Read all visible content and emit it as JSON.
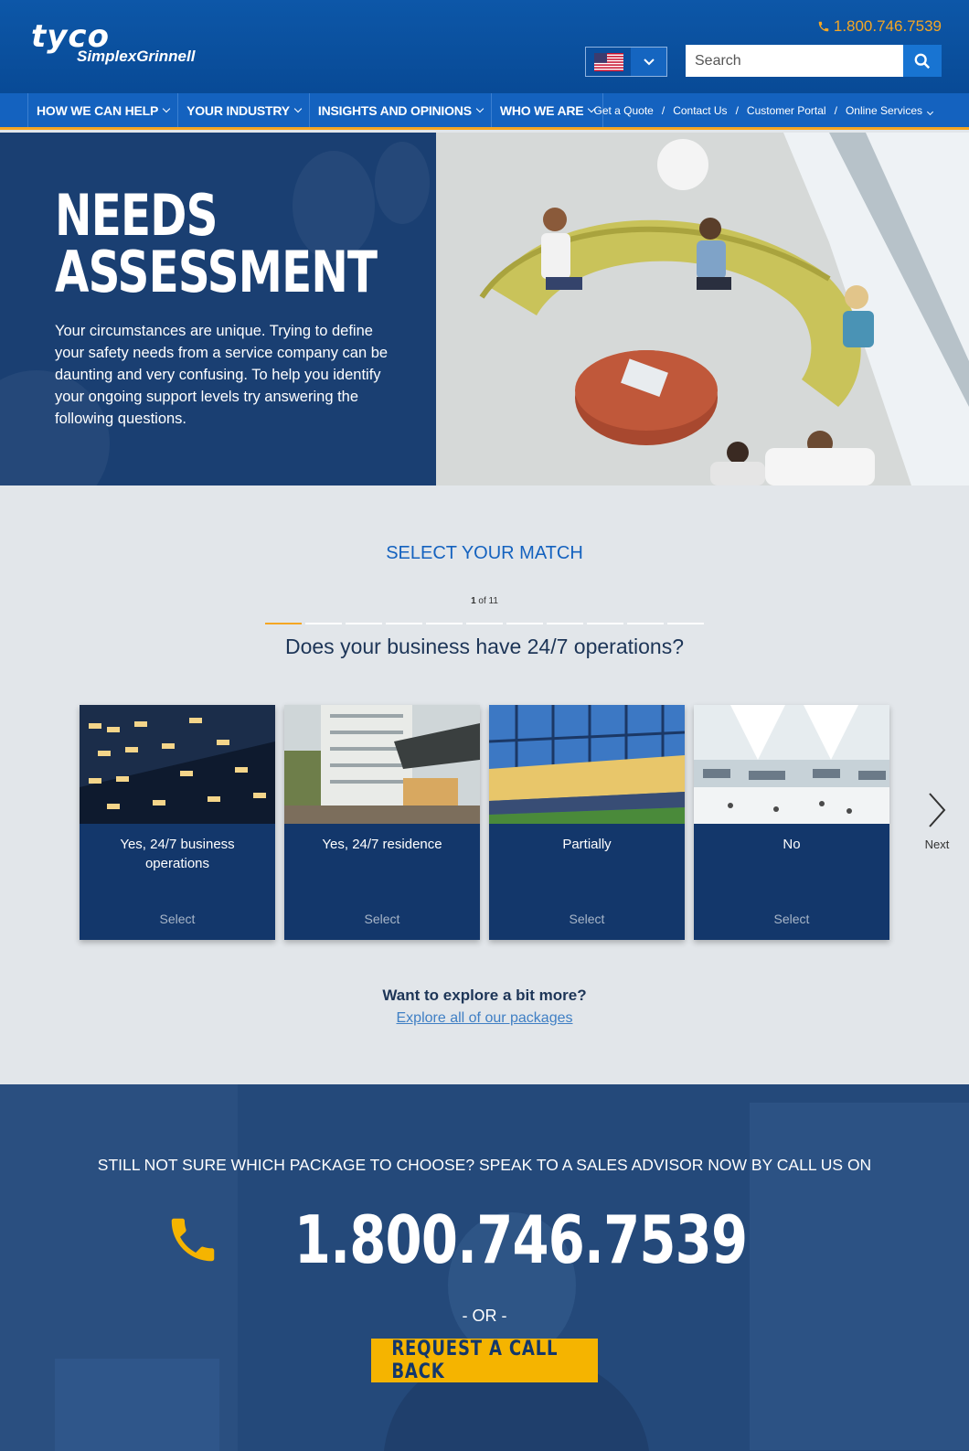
{
  "header": {
    "logo_main": "tyco",
    "logo_sub": "SimplexGrinnell",
    "phone": "1.800.746.7539",
    "search_placeholder": "Search"
  },
  "nav": {
    "main": [
      {
        "label": "HOW WE CAN HELP"
      },
      {
        "label": "YOUR INDUSTRY"
      },
      {
        "label": "INSIGHTS AND OPINIONS"
      },
      {
        "label": "WHO WE ARE"
      }
    ],
    "util": [
      {
        "label": "Get a Quote"
      },
      {
        "label": "Contact Us"
      },
      {
        "label": "Customer Portal"
      },
      {
        "label": "Online Services"
      }
    ],
    "separator": "/"
  },
  "hero": {
    "title_line1": "NEEDS",
    "title_line2": "ASSESSMENT",
    "text": "Your circumstances are unique. Trying to define your safety needs from a service company can be daunting and very confusing. To help you identify your ongoing support levels try answering the following questions."
  },
  "quiz": {
    "section_title": "SELECT YOUR MATCH",
    "progress_current": "1",
    "progress_of": "of 11",
    "progress_fraction": 0.0909,
    "question": "Does your business have 24/7 operations?",
    "options": [
      {
        "label": "Yes, 24/7 business operations",
        "select": "Select"
      },
      {
        "label": "Yes, 24/7 residence",
        "select": "Select"
      },
      {
        "label": "Partially",
        "select": "Select"
      },
      {
        "label": "No",
        "select": "Select"
      }
    ],
    "next_label": "Next"
  },
  "explore": {
    "question": "Want to explore a bit more?",
    "link": "Explore all of our packages"
  },
  "cta": {
    "text": "STILL NOT SURE WHICH PACKAGE TO CHOOSE? SPEAK TO A SALES ADVISOR NOW BY CALL US ON",
    "phone": "1.800.746.7539",
    "or": "- OR -",
    "button": "REQUEST A CALL BACK"
  },
  "colors": {
    "header_blue": "#0d57a8",
    "nav_blue": "#1462bf",
    "accent_orange": "#f5a623",
    "card_navy": "#13376b",
    "cta_yellow": "#f5b400"
  }
}
